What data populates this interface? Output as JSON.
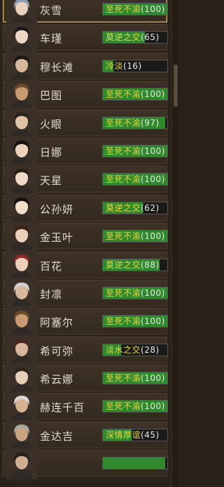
{
  "characters": [
    {
      "name": "灰雪",
      "relation": "至死不渝",
      "score": "(100)",
      "fill": 1.0,
      "skin": "#e9d2bf",
      "hair": "#8fa0b4"
    },
    {
      "name": "车瑾",
      "relation": "莫逆之交",
      "score": "(65)",
      "fill": 0.65,
      "skin": "#ecd7c4",
      "hair": "#1c1a1a"
    },
    {
      "name": "穆长滩",
      "relation": "冷淡",
      "score": "(16)",
      "fill": 0.16,
      "skin": "#d8b89a",
      "hair": "#1a1816"
    },
    {
      "name": "巴图",
      "relation": "至死不渝",
      "score": "(100)",
      "fill": 1.0,
      "skin": "#c89c72",
      "hair": "#6b4a2b"
    },
    {
      "name": "火眼",
      "relation": "至死不渝",
      "score": "(97)",
      "fill": 0.97,
      "skin": "#e0c2a4",
      "hair": "#2a2420"
    },
    {
      "name": "日娜",
      "relation": "至死不渝",
      "score": "(100)",
      "fill": 1.0,
      "skin": "#ecd3bd",
      "hair": "#16130f"
    },
    {
      "name": "天星",
      "relation": "至死不渝",
      "score": "(100)",
      "fill": 1.0,
      "skin": "#eed9c7",
      "hair": "#2a1e15"
    },
    {
      "name": "公孙妍",
      "relation": "莫逆之交",
      "score": "(62)",
      "fill": 0.62,
      "skin": "#efdcc9",
      "hair": "#141111"
    },
    {
      "name": "金玉叶",
      "relation": "至死不渝",
      "score": "(100)",
      "fill": 1.0,
      "skin": "#ecd1ba",
      "hair": "#3a2316"
    },
    {
      "name": "百花",
      "relation": "莫逆之交",
      "score": "(88)",
      "fill": 0.88,
      "skin": "#ecd0b9",
      "hair": "#8a2a2a"
    },
    {
      "name": "封凛",
      "relation": "至死不渝",
      "score": "(100)",
      "fill": 1.0,
      "skin": "#d7b89b",
      "hair": "#cfcfcf"
    },
    {
      "name": "阿塞尔",
      "relation": "至死不渝",
      "score": "(100)",
      "fill": 1.0,
      "skin": "#c99b73",
      "hair": "#6a4a2c"
    },
    {
      "name": "希可弥",
      "relation": "淡水之交",
      "score": "(28)",
      "fill": 0.28,
      "skin": "#d9b59a",
      "hair": "#4a2820"
    },
    {
      "name": "希云娜",
      "relation": "至死不渝",
      "score": "(100)",
      "fill": 1.0,
      "skin": "#e6cdb6",
      "hair": "#2e2420"
    },
    {
      "name": "赫连千百",
      "relation": "至死不渝",
      "score": "(100)",
      "fill": 1.0,
      "skin": "#d5b294",
      "hair": "#d8d8d8"
    },
    {
      "name": "金达吉",
      "relation": "深情厚谊",
      "score": "(45)",
      "fill": 0.45,
      "skin": "#caa383",
      "hair": "#a8a8a0"
    },
    {
      "name": "",
      "relation": "",
      "score": "",
      "fill": 0.97,
      "skin": "#cfae92",
      "hair": "#2a2018"
    }
  ],
  "colors": {
    "bar_fill": "#2e8a2a",
    "relation_text": "#ecd64a",
    "name_text": "#e4dccb"
  }
}
